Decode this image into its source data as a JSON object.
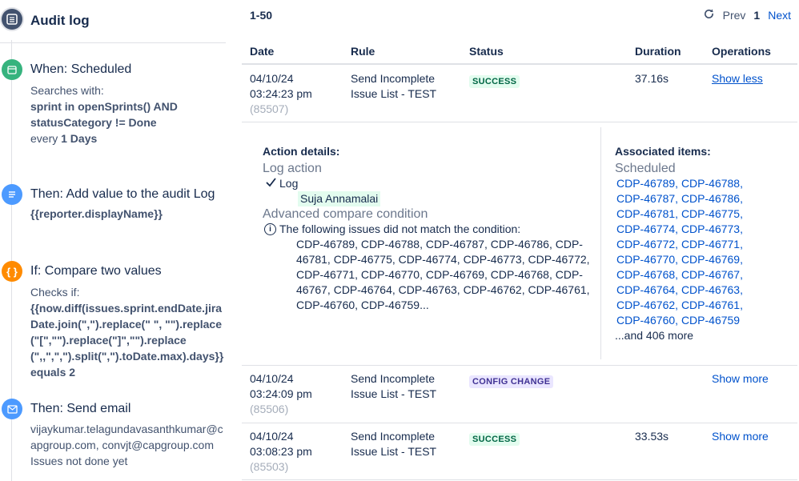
{
  "audit": {
    "title": "Audit log"
  },
  "steps": [
    {
      "title": "When: Scheduled",
      "lines": [
        "Searches with:"
      ],
      "jql": [
        "sprint in openSprints() AND",
        "statusCategory != Done"
      ],
      "every_prefix": "every",
      "every_value": "1 Days"
    },
    {
      "title": "Then: Add value to the audit Log",
      "value": "{{reporter.displayName}}"
    },
    {
      "title": "If: Compare two values",
      "prefix": "Checks if:",
      "expr": "{{now.diff(issues.sprint.endDate.jiraDate.join(\",\").replace(\" \", \"\").replace(\"[\",\"\").replace(\"]\",\"\").replace(\",,\",\",\").split(\",\").toDate.max).days}} equals 2"
    },
    {
      "title": "Then: Send email",
      "to": "vijaykumar.telagundavasanthkumar@capgroup.com, convjt@capgroup.com",
      "subject": "Issues not done yet"
    }
  ],
  "pager": {
    "range": "1-50",
    "prev": "Prev",
    "page": "1",
    "next": "Next"
  },
  "columns": {
    "date": "Date",
    "rule": "Rule",
    "status": "Status",
    "duration": "Duration",
    "operations": "Operations"
  },
  "rows": [
    {
      "date": "04/10/24",
      "time": "03:24:23 pm",
      "id": "(85507)",
      "rule1": "Send Incomplete",
      "rule2": "Issue List - TEST",
      "status": "SUCCESS",
      "duration": "37.16s",
      "op": "Show less"
    },
    {
      "date": "04/10/24",
      "time": "03:24:09 pm",
      "id": "(85506)",
      "rule1": "Send Incomplete",
      "rule2": "Issue List - TEST",
      "status": "CONFIG CHANGE",
      "duration": "",
      "op": "Show more"
    },
    {
      "date": "04/10/24",
      "time": "03:08:23 pm",
      "id": "(85503)",
      "rule1": "Send Incomplete",
      "rule2": "Issue List - TEST",
      "status": "SUCCESS",
      "duration": "33.53s",
      "op": "Show more"
    }
  ],
  "details": {
    "action_heading": "Action details:",
    "log_action": "Log action",
    "log_label": "Log",
    "log_user": "Suja Annamalai",
    "compare_heading": "Advanced compare condition",
    "compare_msg": "The following issues did not match the condition:",
    "issues_text": "CDP-46789, CDP-46788, CDP-46787, CDP-46786, CDP-46781, CDP-46775, CDP-46774, CDP-46773, CDP-46772, CDP-46771, CDP-46770, CDP-46769, CDP-46768, CDP-46767, CDP-46764, CDP-46763, CDP-46762, CDP-46761, CDP-46760, CDP-46759...",
    "assoc_heading": "Associated items:",
    "assoc_sub": "Scheduled",
    "assoc_items": [
      "CDP-46789,",
      "CDP-46788,",
      "CDP-46787,",
      "CDP-46786,",
      "CDP-46781,",
      "CDP-46775,",
      "CDP-46774,",
      "CDP-46773,",
      "CDP-46772,",
      "CDP-46771,",
      "CDP-46770,",
      "CDP-46769,",
      "CDP-46768,",
      "CDP-46767,",
      "CDP-46764,",
      "CDP-46763,",
      "CDP-46762,",
      "CDP-46761,",
      "CDP-46760,",
      "CDP-46759"
    ],
    "assoc_more": "...and 406 more"
  },
  "colors": {
    "link": "#0052cc",
    "success_bg": "#e3fcef",
    "success_fg": "#006644",
    "config_bg": "#eae6ff",
    "config_fg": "#403294",
    "trigger": "#36b37e",
    "action": "#4c9aff",
    "condition": "#ff8b00"
  }
}
